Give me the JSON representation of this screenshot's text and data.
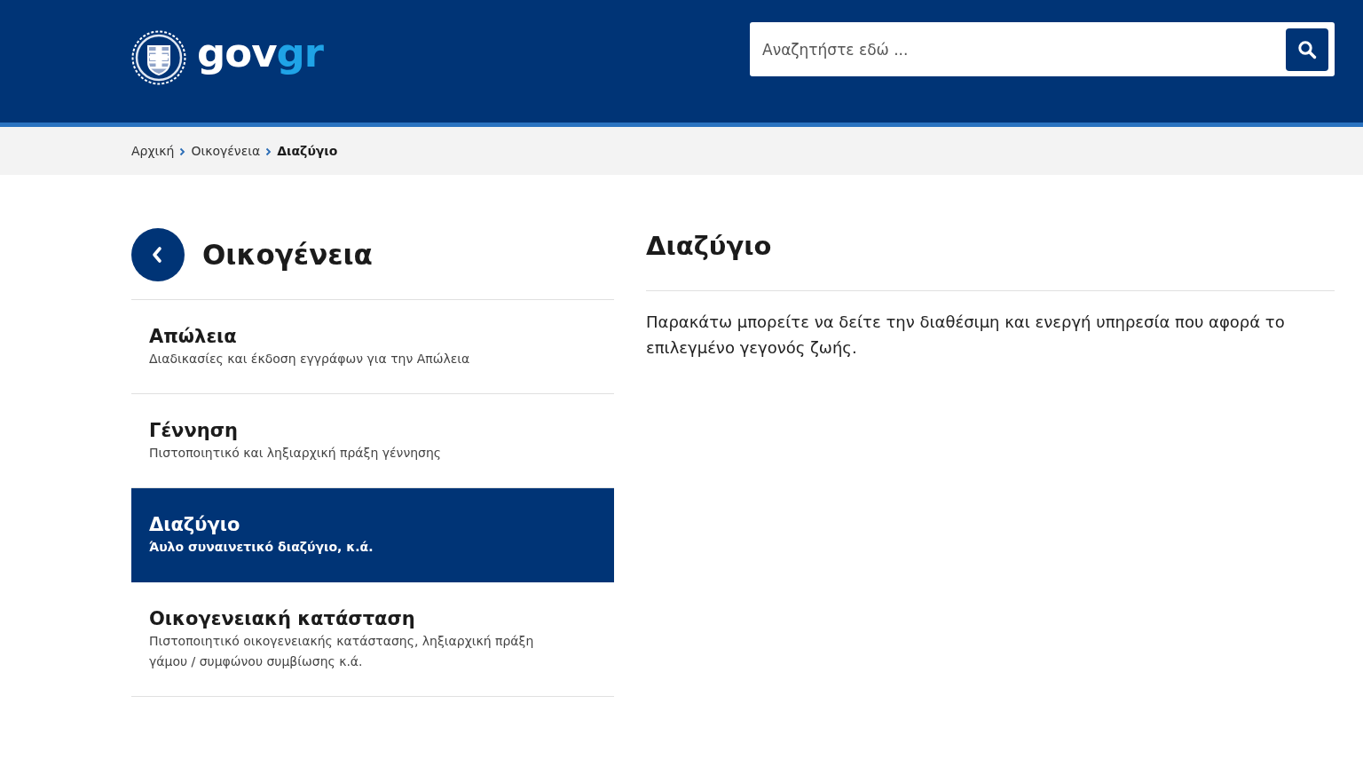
{
  "header": {
    "logo": {
      "text": "gov",
      "accent": "gr"
    },
    "search": {
      "placeholder": "Αναζητήστε εδώ ..."
    }
  },
  "breadcrumb": [
    {
      "label": "Αρχική",
      "current": false
    },
    {
      "label": "Οικογένεια",
      "current": false
    },
    {
      "label": "Διαζύγιο",
      "current": true
    }
  ],
  "sidebar": {
    "title": "Οικογένεια",
    "items": [
      {
        "title": "Απώλεια",
        "description": "Διαδικασίες και έκδοση εγγράφων για την Απώλεια",
        "selected": false
      },
      {
        "title": "Γέννηση",
        "description": "Πιστοποιητικό και ληξιαρχική πράξη γέννησης",
        "selected": false
      },
      {
        "title": "Διαζύγιο",
        "description": "Άυλο συναινετικό διαζύγιο, κ.ά.",
        "selected": true
      },
      {
        "title": "Οικογενειακή κατάσταση",
        "description": "Πιστοποιητικό οικογενειακής κατάστασης, ληξιαρχική πράξη γάμου / συμφώνου συμβίωσης κ.ά.",
        "selected": false
      }
    ]
  },
  "content": {
    "title": "Διαζύγιο",
    "text": "Παρακάτω μπορείτε να δείτε την διαθέσιμη και ενεργή υπηρεσία που αφορά το επιλεγμένο γεγονός ζωής."
  }
}
